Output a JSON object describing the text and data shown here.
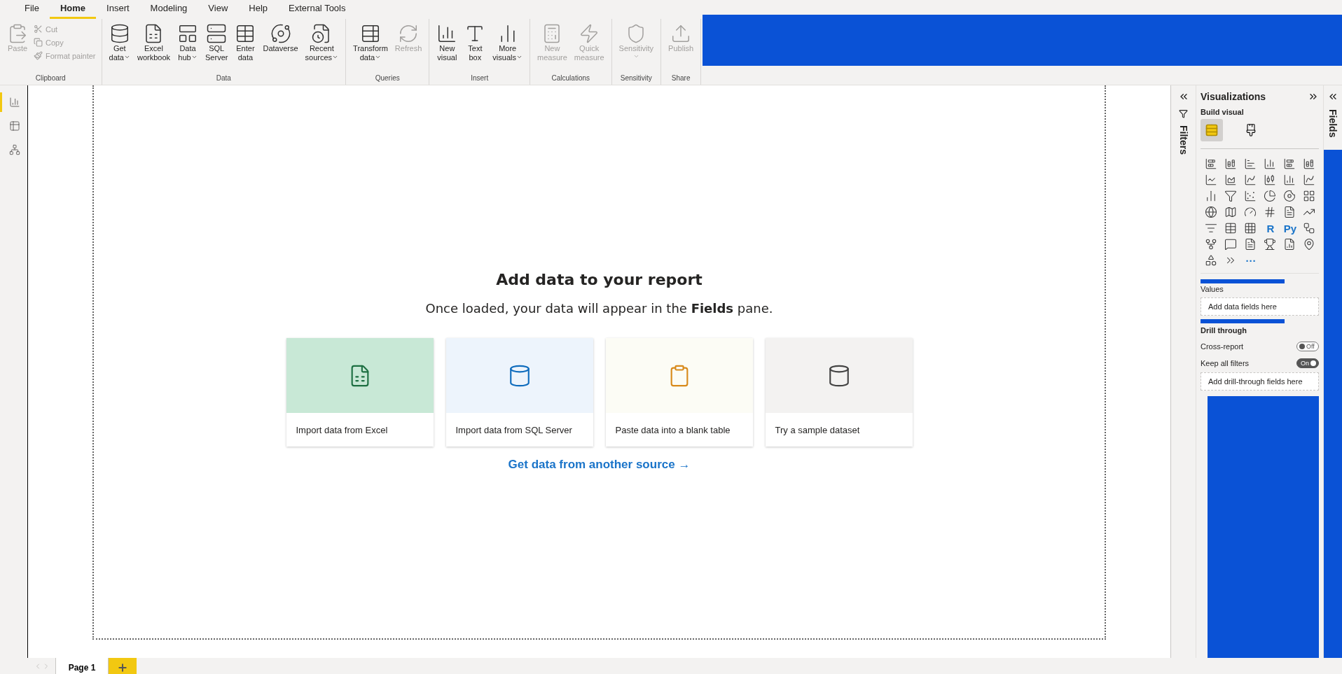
{
  "menu": [
    {
      "label": "File",
      "selected": false
    },
    {
      "label": "Home",
      "selected": true
    },
    {
      "label": "Insert",
      "selected": false
    },
    {
      "label": "Modeling",
      "selected": false
    },
    {
      "label": "View",
      "selected": false
    },
    {
      "label": "Help",
      "selected": false
    },
    {
      "label": "External Tools",
      "selected": false
    }
  ],
  "ribbon": [
    {
      "label": "Clipboard",
      "buttons": [
        {
          "kind": "large",
          "label": "Paste",
          "disabled": true,
          "dropdown": false
        },
        {
          "kind": "small",
          "label": "Cut",
          "disabled": true,
          "dropdown": false
        },
        {
          "kind": "small",
          "label": "Copy",
          "disabled": true,
          "dropdown": false
        },
        {
          "kind": "small",
          "label": "Format painter",
          "disabled": true,
          "dropdown": false
        }
      ]
    },
    {
      "label": "Data",
      "buttons": [
        {
          "kind": "large",
          "label": "Get\ndata",
          "disabled": false,
          "dropdown": true
        },
        {
          "kind": "large",
          "label": "Excel\nworkbook",
          "disabled": false,
          "dropdown": false
        },
        {
          "kind": "large",
          "label": "Data\nhub",
          "disabled": false,
          "dropdown": true
        },
        {
          "kind": "large",
          "label": "SQL\nServer",
          "disabled": false,
          "dropdown": false
        },
        {
          "kind": "large",
          "label": "Enter\ndata",
          "disabled": false,
          "dropdown": false
        },
        {
          "kind": "large",
          "label": "Dataverse",
          "disabled": false,
          "dropdown": false
        },
        {
          "kind": "large",
          "label": "Recent\nsources",
          "disabled": false,
          "dropdown": true
        }
      ]
    },
    {
      "label": "Queries",
      "buttons": [
        {
          "kind": "large",
          "label": "Transform\ndata",
          "disabled": false,
          "dropdown": true
        },
        {
          "kind": "large",
          "label": "Refresh",
          "disabled": true,
          "dropdown": false
        }
      ]
    },
    {
      "label": "Insert",
      "buttons": [
        {
          "kind": "large",
          "label": "New\nvisual",
          "disabled": false,
          "dropdown": false
        },
        {
          "kind": "large",
          "label": "Text\nbox",
          "disabled": false,
          "dropdown": false
        },
        {
          "kind": "large",
          "label": "More\nvisuals",
          "disabled": false,
          "dropdown": true
        }
      ]
    },
    {
      "label": "Calculations",
      "buttons": [
        {
          "kind": "large",
          "label": "New\nmeasure",
          "disabled": true,
          "dropdown": false
        },
        {
          "kind": "large",
          "label": "Quick\nmeasure",
          "disabled": true,
          "dropdown": false
        }
      ]
    },
    {
      "label": "Sensitivity",
      "buttons": [
        {
          "kind": "stacked",
          "label": "Sensitivity",
          "disabled": true,
          "dropdown": true
        }
      ]
    },
    {
      "label": "Share",
      "buttons": [
        {
          "kind": "large",
          "label": "Publish",
          "disabled": true,
          "dropdown": false
        }
      ]
    }
  ],
  "nav": [
    {
      "selected": true
    },
    {
      "selected": false
    },
    {
      "selected": false
    }
  ],
  "welcome": {
    "title": "Add data to your report",
    "subtitle": "Once loaded, your data will appear in the **Fields** pane.",
    "cards": [
      {
        "label": "Import data from Excel",
        "color": "#c8e8d6"
      },
      {
        "label": "Import data from SQL Server",
        "color": "#edf4fc"
      },
      {
        "label": "Paste data into a blank table",
        "color": "#fcfcf5"
      },
      {
        "label": "Try a sample dataset",
        "color": "#f3f2f1"
      }
    ],
    "link": "Get data from another source →"
  },
  "filters": {
    "title": "Filters"
  },
  "visualizations": {
    "title": "Visualizations",
    "build_label": "Build visual",
    "modes": [
      {
        "selected": true
      },
      {
        "selected": false
      }
    ],
    "types": [
      {
        "kind": "icon"
      },
      {
        "kind": "icon"
      },
      {
        "kind": "icon"
      },
      {
        "kind": "icon"
      },
      {
        "kind": "icon"
      },
      {
        "kind": "icon"
      },
      {
        "kind": "icon"
      },
      {
        "kind": "icon"
      },
      {
        "kind": "icon"
      },
      {
        "kind": "icon"
      },
      {
        "kind": "icon"
      },
      {
        "kind": "icon"
      },
      {
        "kind": "icon"
      },
      {
        "kind": "icon"
      },
      {
        "kind": "icon"
      },
      {
        "kind": "icon"
      },
      {
        "kind": "icon"
      },
      {
        "kind": "icon"
      },
      {
        "kind": "icon"
      },
      {
        "kind": "icon"
      },
      {
        "kind": "icon"
      },
      {
        "kind": "icon"
      },
      {
        "kind": "icon"
      },
      {
        "kind": "icon"
      },
      {
        "kind": "icon"
      },
      {
        "kind": "icon"
      },
      {
        "kind": "icon"
      },
      {
        "kind": "text",
        "text": "R"
      },
      {
        "kind": "text",
        "text": "Py"
      },
      {
        "kind": "icon"
      },
      {
        "kind": "icon"
      },
      {
        "kind": "icon"
      },
      {
        "kind": "icon"
      },
      {
        "kind": "icon"
      },
      {
        "kind": "icon"
      },
      {
        "kind": "icon"
      },
      {
        "kind": "icon"
      },
      {
        "kind": "icon"
      },
      {
        "kind": "text",
        "text": "···"
      }
    ],
    "values_label": "Values",
    "values_placeholder": "Add data fields here",
    "drill_label": "Drill through",
    "toggles": [
      {
        "label": "Cross-report",
        "on": false,
        "state_text": "Off"
      },
      {
        "label": "Keep all filters",
        "on": true,
        "state_text": "On"
      }
    ],
    "drill_placeholder": "Add drill-through fields here"
  },
  "fields": {
    "title": "Fields"
  },
  "pages": [
    {
      "label": "Page 1",
      "selected": true
    }
  ]
}
